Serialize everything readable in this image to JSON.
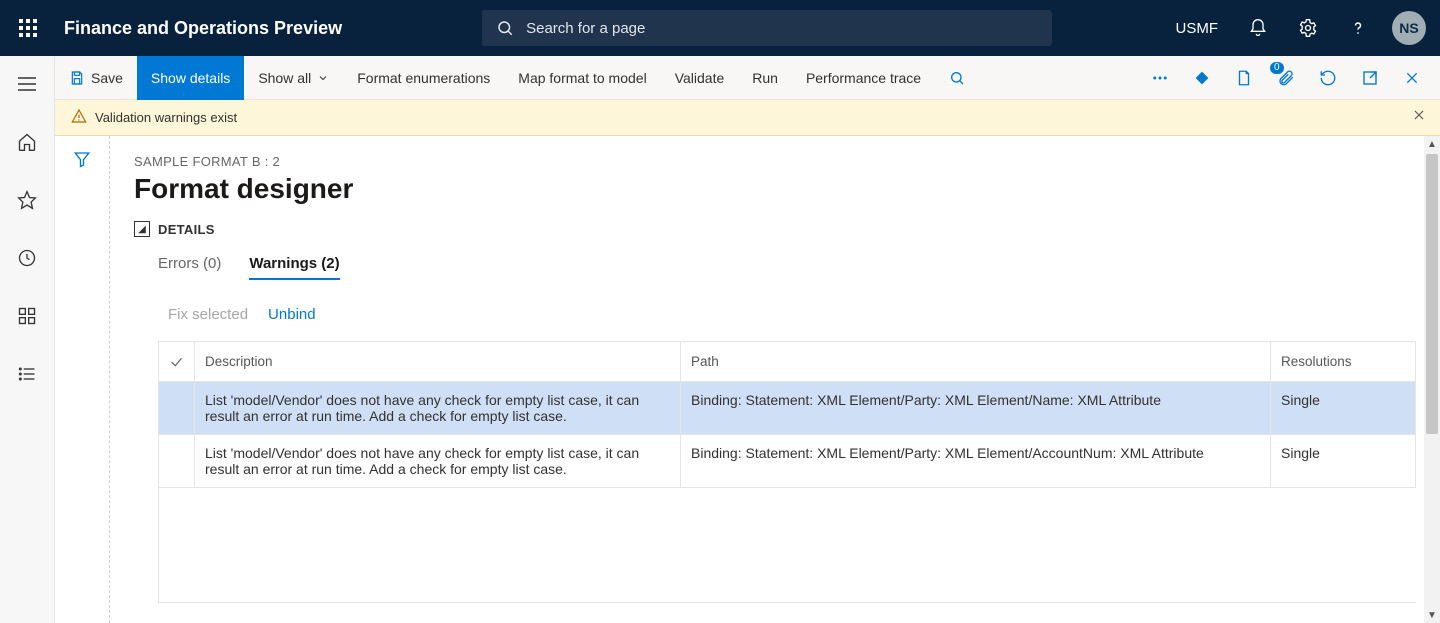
{
  "header": {
    "app_title": "Finance and Operations Preview",
    "search_placeholder": "Search for a page",
    "legal_entity": "USMF",
    "user_initials": "NS"
  },
  "commandbar": {
    "save": "Save",
    "show_details": "Show details",
    "show_all": "Show all",
    "format_enum": "Format enumerations",
    "map_format": "Map format to model",
    "validate": "Validate",
    "run": "Run",
    "perf_trace": "Performance trace",
    "attach_badge": "0"
  },
  "messagebar": {
    "text": "Validation warnings exist"
  },
  "page": {
    "breadcrumb": "SAMPLE FORMAT B : 2",
    "title": "Format designer",
    "details_label": "DETAILS"
  },
  "tabs": {
    "errors": "Errors (0)",
    "warnings": "Warnings (2)"
  },
  "subcommands": {
    "fix_selected": "Fix selected",
    "unbind": "Unbind"
  },
  "grid": {
    "headers": {
      "description": "Description",
      "path": "Path",
      "resolutions": "Resolutions"
    },
    "rows": [
      {
        "description": "List 'model/Vendor' does not have any check for empty list case, it can result an error at run time. Add a check for empty list case.",
        "path": "Binding: Statement: XML Element/Party: XML Element/Name: XML Attribute",
        "resolutions": "Single"
      },
      {
        "description": "List 'model/Vendor' does not have any check for empty list case, it can result an error at run time. Add a check for empty list case.",
        "path": "Binding: Statement: XML Element/Party: XML Element/AccountNum: XML Attribute",
        "resolutions": "Single"
      }
    ]
  }
}
